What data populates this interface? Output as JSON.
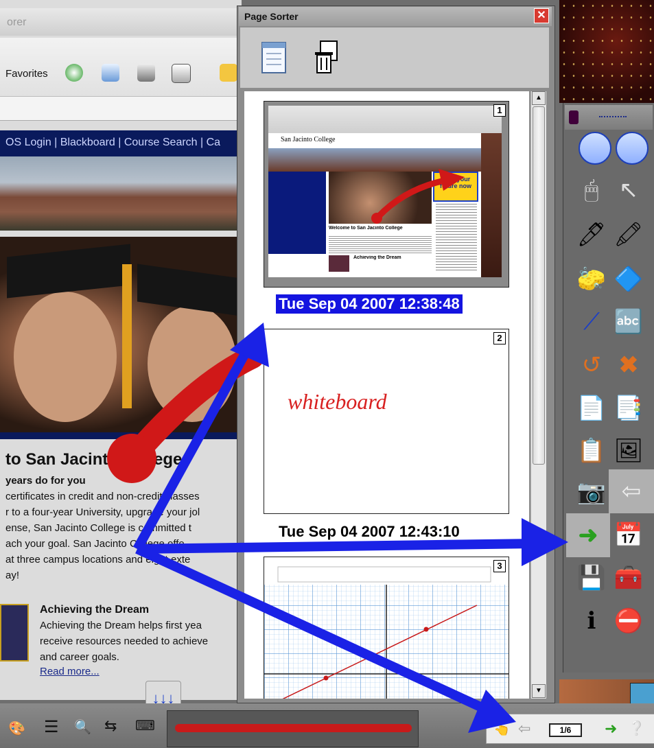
{
  "browser": {
    "title_fragment": "orer",
    "favorites_label": "Favorites",
    "nav_links": "OS Login | Blackboard | Course Search | Ca",
    "heading": "to San Jacinto College",
    "paragraph_lines": [
      "years do for you",
      "certificates in credit and non-credit classes",
      "r to a four-year University, upgrade your jol",
      "ense, San Jacinto College is committed t",
      "ach your goal.  San Jacinto College offe",
      "at three campus locations and eight exte",
      "ay!"
    ],
    "news_title": "Achieving the Dream",
    "news_lines": [
      "Achieving the Dream helps first yea",
      "receive resources needed to achieve",
      "and career goals."
    ],
    "read_more": "Read more..."
  },
  "page_sorter": {
    "title": "Page Sorter",
    "close_glyph": "✕",
    "pages": [
      {
        "number": "1",
        "timestamp": "Tue Sep 04 2007 12:38:48",
        "selected": true
      },
      {
        "number": "2",
        "handwriting": "whiteboard",
        "timestamp": "Tue Sep 04 2007 12:43:10",
        "selected": false
      },
      {
        "number": "3"
      }
    ],
    "thumbnail_1": {
      "site_name": "San Jacinto College",
      "promo_line1": "Start your",
      "promo_line2": "future now",
      "welcome_heading": "Welcome to San Jacinto College",
      "news_heading": "Achieving the Dream"
    }
  },
  "taskbar": {
    "page_indicator": "1/6"
  },
  "colors": {
    "annotation_blue": "#1a22e6",
    "annotation_red": "#d01818",
    "selection_highlight": "#1414e0",
    "college_navy": "#0a1a5c"
  }
}
